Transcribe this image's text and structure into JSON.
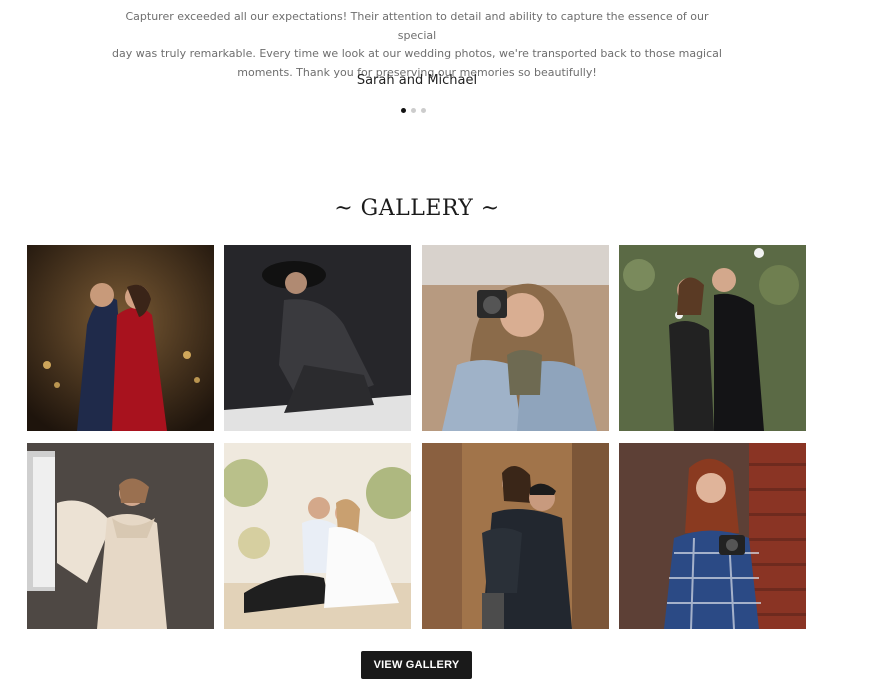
{
  "testimonial": {
    "quote_lines": [
      "Capturer exceeded all our expectations! Their attention to detail and ability to capture the essence of our special",
      "day was truly remarkable. Every time we look at our wedding photos, we're transported back to those magical",
      "moments. Thank you for preserving our memories so beautifully!"
    ],
    "author": "Sarah and Michael",
    "slides_total": 3,
    "active_slide": 1
  },
  "gallery": {
    "title": "~ GALLERY ~",
    "button_label": "VIEW GALLERY",
    "photos": [
      {
        "subject": "wedding-couple-kiss-photo",
        "bg": "#3a2a1a",
        "accent": "#b3202a"
      },
      {
        "subject": "fashion-model-black-outfit-photo",
        "bg": "#1e1e22",
        "accent": "#3b3b3b"
      },
      {
        "subject": "woman-with-camera-photo",
        "bg": "#8a6b52",
        "accent": "#9fb2c8"
      },
      {
        "subject": "couple-in-garden-photo",
        "bg": "#55633f",
        "accent": "#1a1a1a"
      },
      {
        "subject": "woman-ruffled-dress-photo",
        "bg": "#4a4440",
        "accent": "#e6d8c6"
      },
      {
        "subject": "wedding-couple-beach-photo",
        "bg": "#e8e0d2",
        "accent": "#2a2a2a"
      },
      {
        "subject": "couple-piggyback-autumn-photo",
        "bg": "#9a6a3e",
        "accent": "#23282f"
      },
      {
        "subject": "woman-with-camera-brick-wall-photo",
        "bg": "#5a3a30",
        "accent": "#2b4a85"
      }
    ]
  }
}
